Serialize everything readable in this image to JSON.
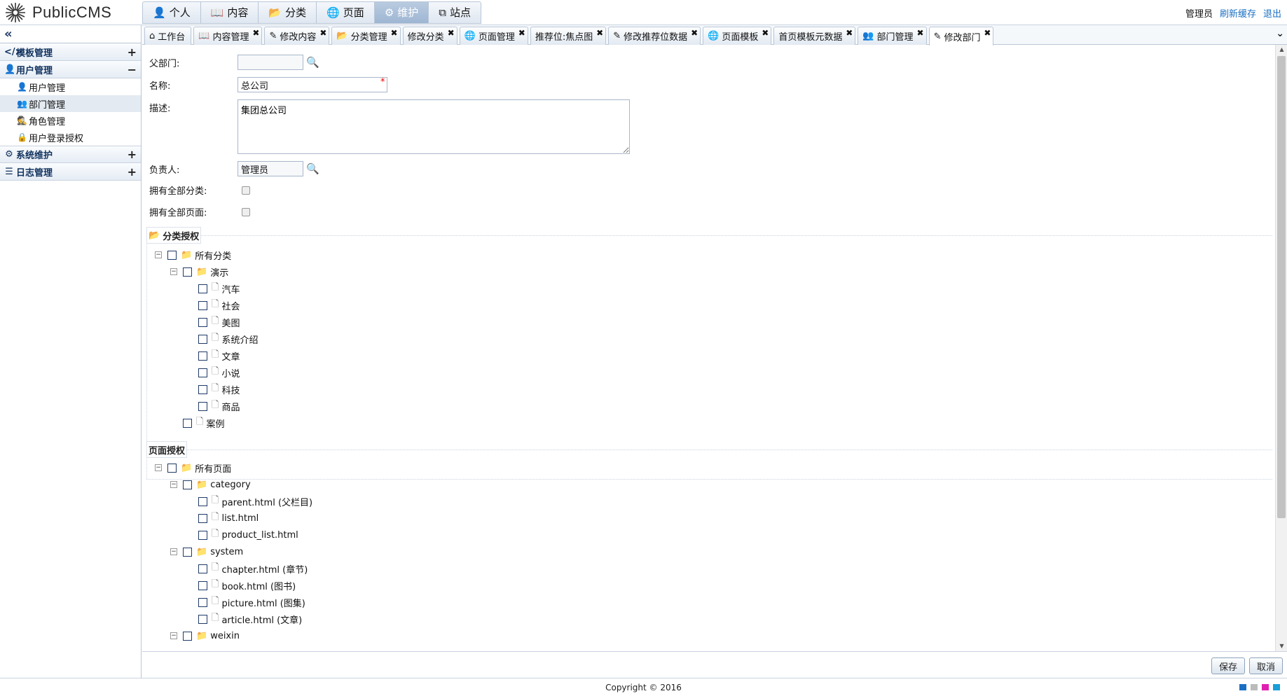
{
  "logo": {
    "text": "PublicCMS"
  },
  "topnav": [
    {
      "label": "个人",
      "icon": "user-icon"
    },
    {
      "label": "内容",
      "icon": "book-icon"
    },
    {
      "label": "分类",
      "icon": "folder-open-icon"
    },
    {
      "label": "页面",
      "icon": "globe-icon"
    },
    {
      "label": "维护",
      "icon": "gears-icon",
      "active": true
    },
    {
      "label": "站点",
      "icon": "sitemap-icon"
    }
  ],
  "topright": {
    "user": "管理员",
    "refresh": "刷新缓存",
    "logout": "退出"
  },
  "sidebar": {
    "groups": [
      {
        "label": "模板管理",
        "icon": "code-icon",
        "toggle": "+"
      },
      {
        "label": "用户管理",
        "icon": "user-icon",
        "toggle": "−"
      },
      {
        "label": "系统维护",
        "icon": "gears-icon",
        "toggle": "+"
      },
      {
        "label": "日志管理",
        "icon": "list-icon",
        "toggle": "+"
      }
    ],
    "items": [
      {
        "label": "用户管理",
        "icon": "user-icon"
      },
      {
        "label": "部门管理",
        "icon": "users-icon",
        "selected": true
      },
      {
        "label": "角色管理",
        "icon": "user-secret-icon"
      },
      {
        "label": "用户登录授权",
        "icon": "lock-icon"
      }
    ]
  },
  "tabs": [
    {
      "label": "工作台",
      "icon": "home-icon"
    },
    {
      "label": "内容管理",
      "icon": "book-icon"
    },
    {
      "label": "修改内容",
      "icon": "edit-icon"
    },
    {
      "label": "分类管理",
      "icon": "folder-open-icon"
    },
    {
      "label": "修改分类",
      "icon": ""
    },
    {
      "label": "页面管理",
      "icon": "globe-icon"
    },
    {
      "label": "推荐位:焦点图",
      "icon": ""
    },
    {
      "label": "修改推荐位数据",
      "icon": "edit-icon"
    },
    {
      "label": "页面模板",
      "icon": "globe-icon"
    },
    {
      "label": "首页模板元数据",
      "icon": ""
    },
    {
      "label": "部门管理",
      "icon": "users-icon"
    },
    {
      "label": "修改部门",
      "icon": "edit-icon",
      "active": true
    }
  ],
  "form": {
    "parent_label": "父部门:",
    "parent_value": "",
    "name_label": "名称:",
    "name_value": "总公司",
    "desc_label": "描述:",
    "desc_value": "集团总公司",
    "owner_label": "负责人:",
    "owner_value": "管理员",
    "owns_all_cat_label": "拥有全部分类:",
    "owns_all_page_label": "拥有全部页面:"
  },
  "cat_auth": {
    "legend": "分类授权",
    "root": "所有分类",
    "demo": "演示",
    "children": [
      "汽车",
      "社会",
      "美图",
      "系统介绍",
      "文章",
      "小说",
      "科技",
      "商品"
    ],
    "case": "案例"
  },
  "page_auth": {
    "legend": "页面授权",
    "root": "所有页面",
    "category": "category",
    "category_files": [
      "parent.html (父栏目)",
      "list.html",
      "product_list.html"
    ],
    "system": "system",
    "system_files": [
      "chapter.html (章节)",
      "book.html (图书)",
      "picture.html (图集)",
      "article.html (文章)"
    ],
    "weixin": "weixin"
  },
  "buttons": {
    "save": "保存",
    "cancel": "取消"
  },
  "footer": {
    "copyright": "Copyright © 2016"
  },
  "colors": {
    "accent": "#1a6fc3",
    "active_nav": "#9eb6d3",
    "border": "#b9c6d6"
  }
}
